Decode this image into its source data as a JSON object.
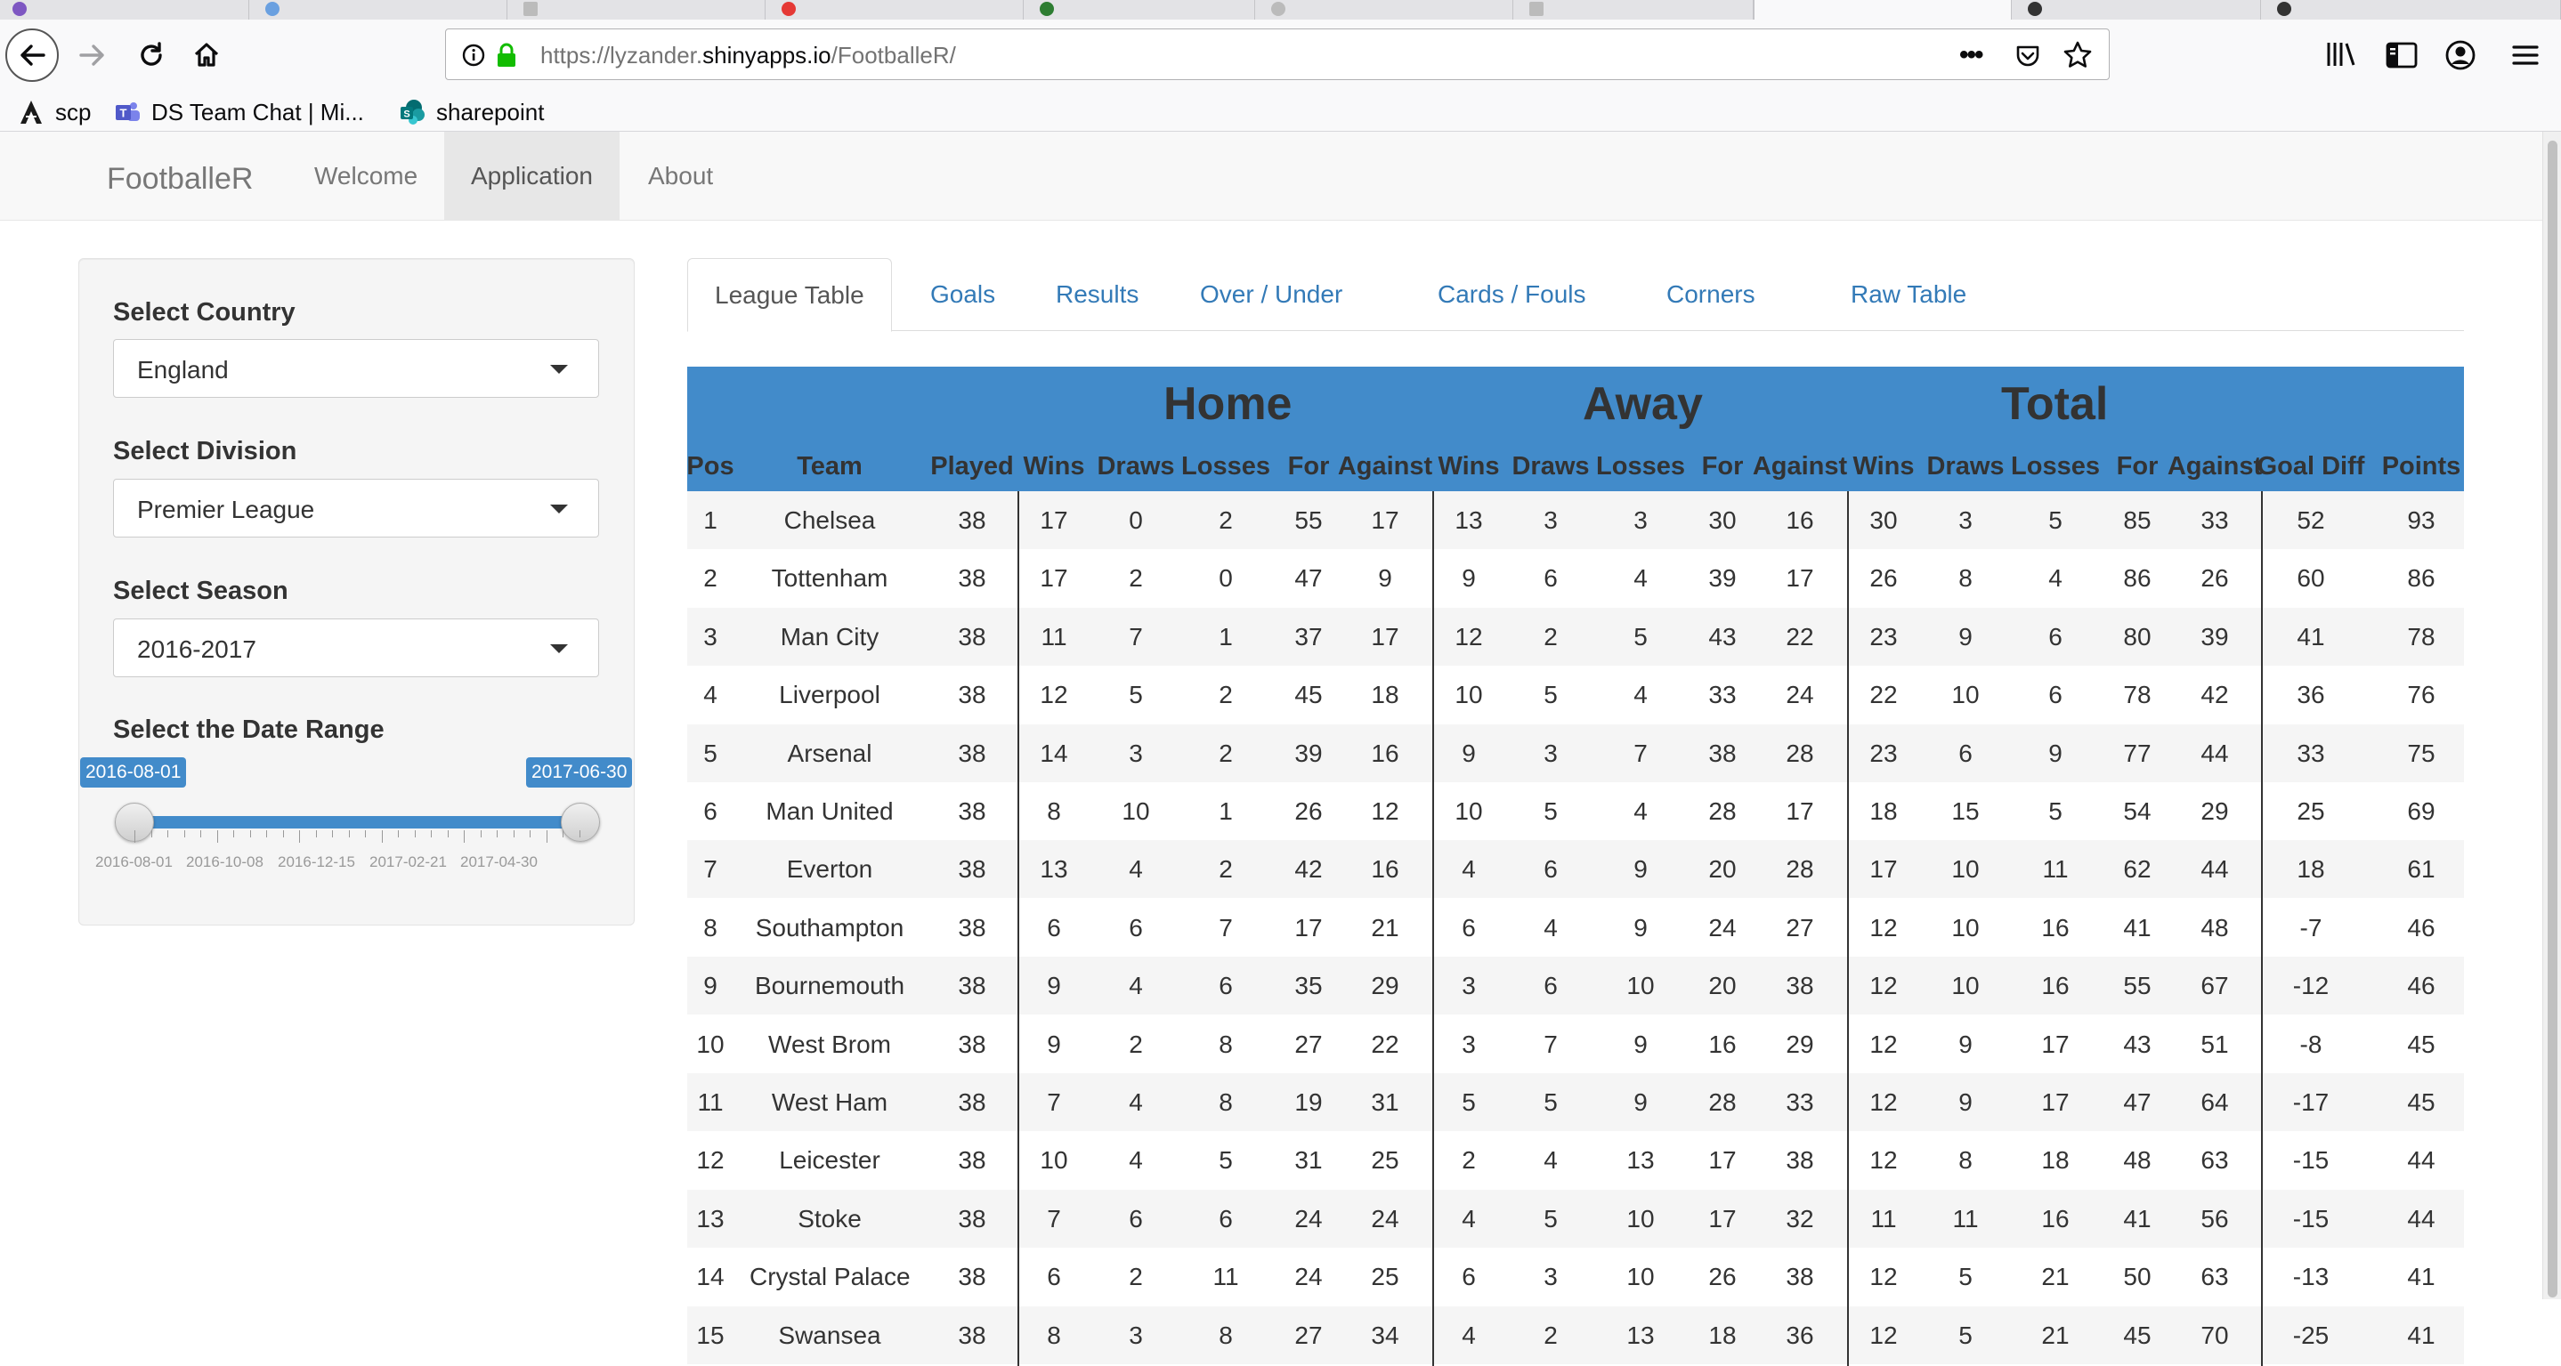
{
  "browser": {
    "url_prefix": "https://lyzander.",
    "url_host": "shinyapps.io",
    "url_path": "/FootballeR/",
    "page_actions": "•••",
    "bookmarks": [
      {
        "label": "scp",
        "icon": "scp-icon"
      },
      {
        "label": "DS Team Chat | Mi...",
        "icon": "teams-icon"
      },
      {
        "label": "sharepoint",
        "icon": "sharepoint-icon"
      }
    ]
  },
  "navbar": {
    "brand": "FootballeR",
    "links": [
      "Welcome",
      "Application",
      "About"
    ],
    "active": "Application"
  },
  "sidebar": {
    "country_label": "Select Country",
    "country_value": "England",
    "division_label": "Select Division",
    "division_value": "Premier League",
    "season_label": "Select Season",
    "season_value": "2016-2017",
    "date_label": "Select the Date Range",
    "date_from": "2016-08-01",
    "date_to": "2017-06-30",
    "tick_labels": [
      "2016-08-01",
      "2016-10-08",
      "2016-12-15",
      "2017-02-21",
      "2017-04-30"
    ]
  },
  "tabs": [
    "League Table",
    "Goals",
    "Results",
    "Over / Under",
    "Cards / Fouls",
    "Corners",
    "Raw Table"
  ],
  "active_tab": "League Table",
  "table": {
    "groups": [
      "Home",
      "Away",
      "Total"
    ],
    "columns": [
      "Pos",
      "Team",
      "Played",
      "Wins",
      "Draws",
      "Losses",
      "For",
      "Against",
      "Wins",
      "Draws",
      "Losses",
      "For",
      "Against",
      "Wins",
      "Draws",
      "Losses",
      "For",
      "Against",
      "Goal Diff",
      "Points"
    ],
    "rows": [
      [
        "1",
        "Chelsea",
        "38",
        "17",
        "0",
        "2",
        "55",
        "17",
        "13",
        "3",
        "3",
        "30",
        "16",
        "30",
        "3",
        "5",
        "85",
        "33",
        "52",
        "93"
      ],
      [
        "2",
        "Tottenham",
        "38",
        "17",
        "2",
        "0",
        "47",
        "9",
        "9",
        "6",
        "4",
        "39",
        "17",
        "26",
        "8",
        "4",
        "86",
        "26",
        "60",
        "86"
      ],
      [
        "3",
        "Man City",
        "38",
        "11",
        "7",
        "1",
        "37",
        "17",
        "12",
        "2",
        "5",
        "43",
        "22",
        "23",
        "9",
        "6",
        "80",
        "39",
        "41",
        "78"
      ],
      [
        "4",
        "Liverpool",
        "38",
        "12",
        "5",
        "2",
        "45",
        "18",
        "10",
        "5",
        "4",
        "33",
        "24",
        "22",
        "10",
        "6",
        "78",
        "42",
        "36",
        "76"
      ],
      [
        "5",
        "Arsenal",
        "38",
        "14",
        "3",
        "2",
        "39",
        "16",
        "9",
        "3",
        "7",
        "38",
        "28",
        "23",
        "6",
        "9",
        "77",
        "44",
        "33",
        "75"
      ],
      [
        "6",
        "Man United",
        "38",
        "8",
        "10",
        "1",
        "26",
        "12",
        "10",
        "5",
        "4",
        "28",
        "17",
        "18",
        "15",
        "5",
        "54",
        "29",
        "25",
        "69"
      ],
      [
        "7",
        "Everton",
        "38",
        "13",
        "4",
        "2",
        "42",
        "16",
        "4",
        "6",
        "9",
        "20",
        "28",
        "17",
        "10",
        "11",
        "62",
        "44",
        "18",
        "61"
      ],
      [
        "8",
        "Southampton",
        "38",
        "6",
        "6",
        "7",
        "17",
        "21",
        "6",
        "4",
        "9",
        "24",
        "27",
        "12",
        "10",
        "16",
        "41",
        "48",
        "-7",
        "46"
      ],
      [
        "9",
        "Bournemouth",
        "38",
        "9",
        "4",
        "6",
        "35",
        "29",
        "3",
        "6",
        "10",
        "20",
        "38",
        "12",
        "10",
        "16",
        "55",
        "67",
        "-12",
        "46"
      ],
      [
        "10",
        "West Brom",
        "38",
        "9",
        "2",
        "8",
        "27",
        "22",
        "3",
        "7",
        "9",
        "16",
        "29",
        "12",
        "9",
        "17",
        "43",
        "51",
        "-8",
        "45"
      ],
      [
        "11",
        "West Ham",
        "38",
        "7",
        "4",
        "8",
        "19",
        "31",
        "5",
        "5",
        "9",
        "28",
        "33",
        "12",
        "9",
        "17",
        "47",
        "64",
        "-17",
        "45"
      ],
      [
        "12",
        "Leicester",
        "38",
        "10",
        "4",
        "5",
        "31",
        "25",
        "2",
        "4",
        "13",
        "17",
        "38",
        "12",
        "8",
        "18",
        "48",
        "63",
        "-15",
        "44"
      ],
      [
        "13",
        "Stoke",
        "38",
        "7",
        "6",
        "6",
        "24",
        "24",
        "4",
        "5",
        "10",
        "17",
        "32",
        "11",
        "11",
        "16",
        "41",
        "56",
        "-15",
        "44"
      ],
      [
        "14",
        "Crystal Palace",
        "38",
        "6",
        "2",
        "11",
        "24",
        "25",
        "6",
        "3",
        "10",
        "26",
        "38",
        "12",
        "5",
        "21",
        "50",
        "63",
        "-13",
        "41"
      ],
      [
        "15",
        "Swansea",
        "38",
        "8",
        "3",
        "8",
        "27",
        "34",
        "4",
        "2",
        "13",
        "18",
        "36",
        "12",
        "5",
        "21",
        "45",
        "70",
        "-25",
        "41"
      ]
    ]
  },
  "colors": {
    "header_blue": "#428bca",
    "link_blue": "#337ab7",
    "row_stripe": "#f5f5f5"
  }
}
